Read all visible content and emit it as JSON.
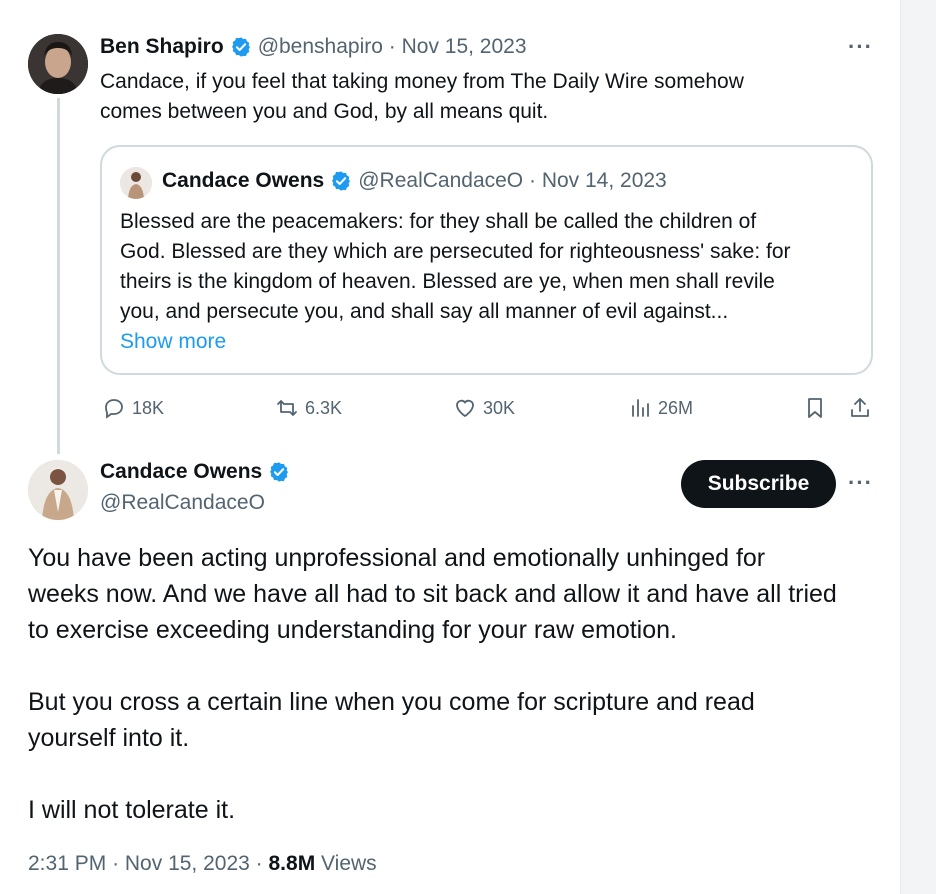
{
  "quoting_tweet": {
    "author_name": "Ben Shapiro",
    "handle": "@benshapiro",
    "date": "Nov 15, 2023",
    "text_line1": "Candace, if you feel that taking money from The Daily Wire somehow",
    "text_line2": "comes between you and God, by all means quit.",
    "more_icon": "more-horizontal-icon",
    "quoted": {
      "author_name": "Candace Owens",
      "handle": "@RealCandaceO",
      "date": "Nov 14, 2023",
      "text_line1": "Blessed are the peacemakers: for they shall be called the children of",
      "text_line2": "God. Blessed are they which are persecuted for righteousness' sake: for",
      "text_line3": "theirs is the kingdom of heaven. Blessed are ye, when men shall revile",
      "text_line4": "you, and persecute you, and shall say all manner of evil against...",
      "show_more": "Show more"
    },
    "metrics": {
      "replies": "18K",
      "reposts": "6.3K",
      "likes": "30K",
      "views": "26M"
    }
  },
  "main_tweet": {
    "author_name": "Candace Owens",
    "handle": "@RealCandaceO",
    "subscribe_label": "Subscribe",
    "paragraph1_line1": "You have been acting unprofessional and emotionally unhinged  for",
    "paragraph1_line2": "weeks now. And we have all had to sit back and allow it and have all tried",
    "paragraph1_line3": "to exercise exceeding understanding for your raw emotion.",
    "paragraph2_line1": "But you cross a certain line when you come for scripture and read",
    "paragraph2_line2": "yourself into it.",
    "paragraph3": "I will not tolerate it.",
    "time": "2:31 PM",
    "date": "Nov 15, 2023",
    "views_count": "8.8M",
    "views_label": "Views"
  },
  "colors": {
    "verified_blue": "#1d9bf0",
    "text_primary": "#0f1419",
    "text_muted": "#536471",
    "border": "#cfd9de"
  }
}
